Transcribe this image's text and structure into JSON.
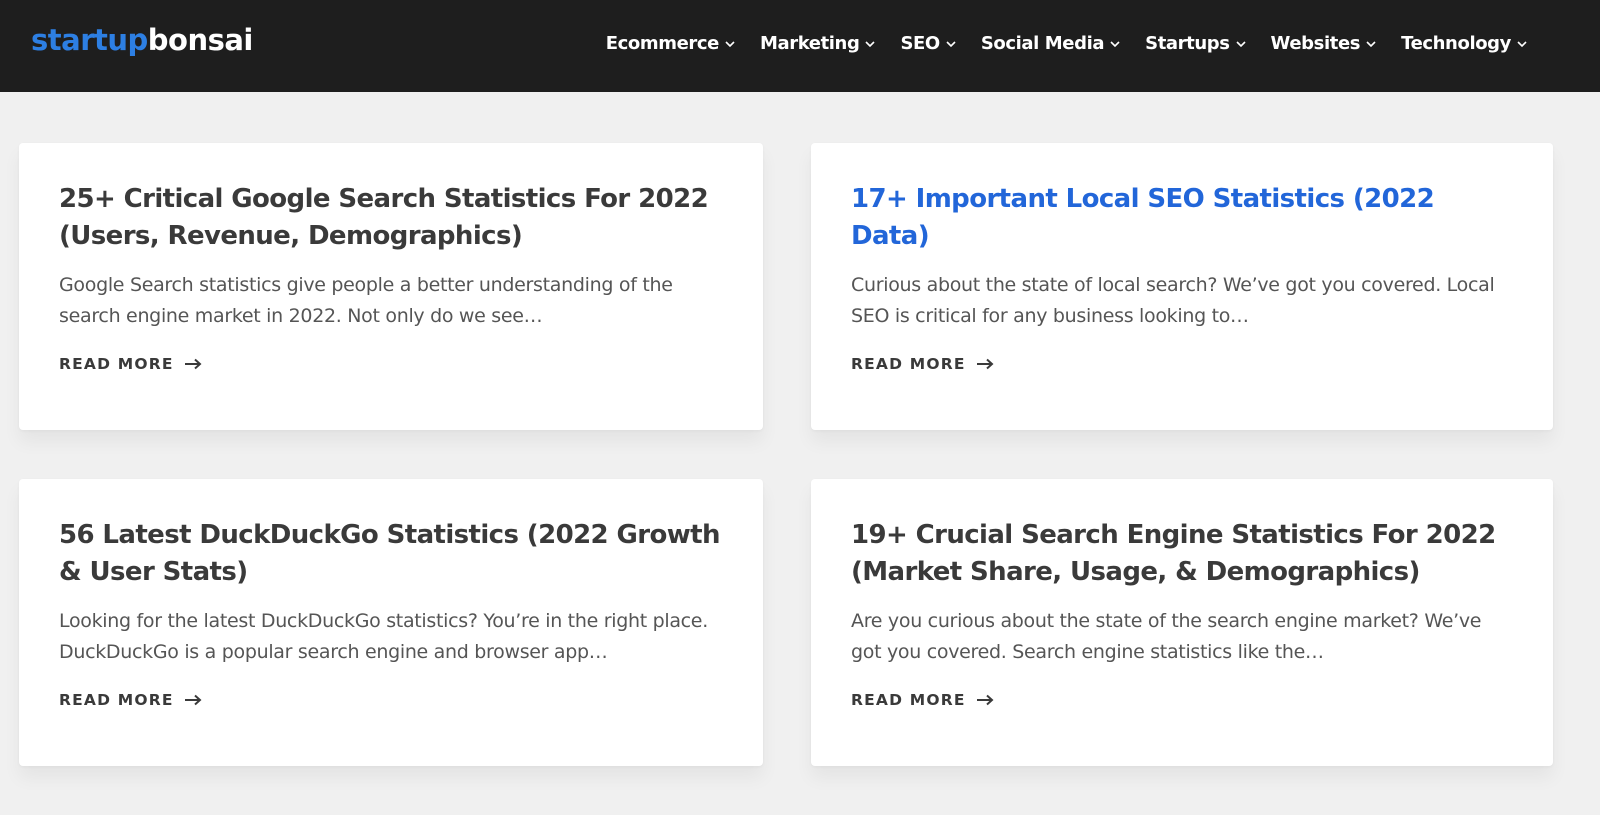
{
  "site": {
    "logo_part1": "startup",
    "logo_part2": "bonsai"
  },
  "nav": {
    "items": [
      {
        "label": "Ecommerce"
      },
      {
        "label": "Marketing"
      },
      {
        "label": "SEO"
      },
      {
        "label": "Social Media"
      },
      {
        "label": "Startups"
      },
      {
        "label": "Websites"
      },
      {
        "label": "Technology"
      }
    ]
  },
  "posts": [
    {
      "title": "25+ Critical Google Search Statistics For 2022 (Users, Revenue, Demographics)",
      "excerpt": "Google Search statistics give people a better understanding of the search engine market in 2022. Not only do we see…",
      "read_more": "READ MORE"
    },
    {
      "title": "17+ Important Local SEO Statistics (2022 Data)",
      "excerpt": "Curious about the state of local search? We’ve got you covered. Local SEO is critical for any business looking to…",
      "read_more": "READ MORE"
    },
    {
      "title": "56 Latest DuckDuckGo Statistics (2022 Growth & User Stats)",
      "excerpt": "Looking for the latest DuckDuckGo statistics? You’re in the right place. DuckDuckGo is a popular search engine and browser app…",
      "read_more": "READ MORE"
    },
    {
      "title": "19+ Crucial Search Engine Statistics For 2022 (Market Share, Usage, & Demographics)",
      "excerpt": "Are you curious about the state of the search engine market? We’ve got you covered. Search engine statistics like the…",
      "read_more": "READ MORE"
    }
  ],
  "colors": {
    "header_bg": "#1e1e1e",
    "logo_accent": "#2d7fe3",
    "link_active": "#2266d9",
    "page_bg": "#f0f0f0"
  }
}
